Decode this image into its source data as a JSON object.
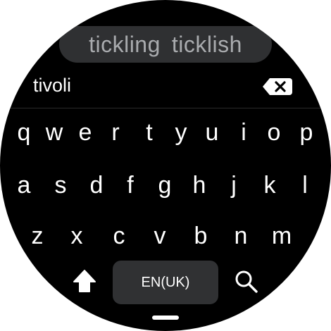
{
  "suggestions": [
    "tickling",
    "ticklish"
  ],
  "input": {
    "value": "tivoli"
  },
  "keyboard": {
    "rows": [
      [
        "q",
        "w",
        "e",
        "r",
        "t",
        "y",
        "u",
        "i",
        "o",
        "p"
      ],
      [
        "a",
        "s",
        "d",
        "f",
        "g",
        "h",
        "j",
        "k",
        "l"
      ],
      [
        "z",
        "x",
        "c",
        "v",
        "b",
        "n",
        "m"
      ]
    ],
    "language_label": "EN(UK)",
    "shift_icon": "shift-arrow-up-icon",
    "search_icon": "search-icon",
    "backspace_icon": "backspace-icon"
  },
  "colors": {
    "background": "#000000",
    "suggestion_bar": "#2f3032",
    "suggestion_text": "#a9abae",
    "key_text": "#ffffff",
    "language_key": "#303133"
  }
}
